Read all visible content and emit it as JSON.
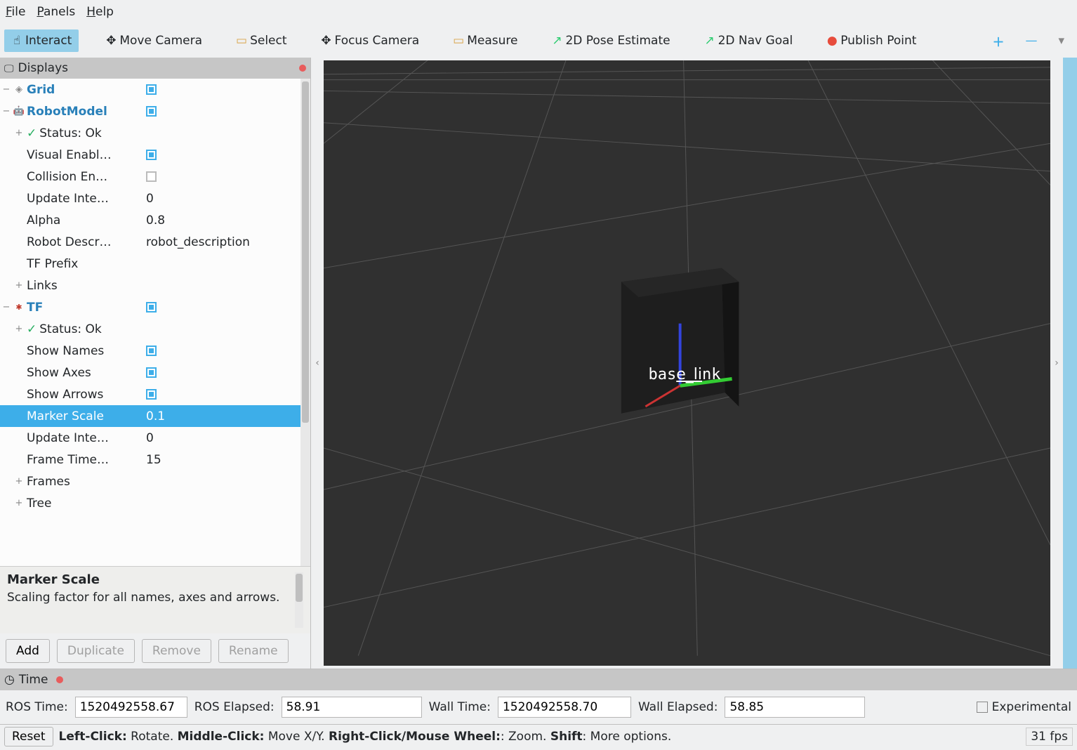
{
  "menu": {
    "file": "File",
    "panels": "Panels",
    "help": "Help"
  },
  "toolbar": {
    "interact": "Interact",
    "move_camera": "Move Camera",
    "select": "Select",
    "focus_camera": "Focus Camera",
    "measure": "Measure",
    "pose_estimate": "2D Pose Estimate",
    "nav_goal": "2D Nav Goal",
    "publish_point": "Publish Point"
  },
  "displays": {
    "title": "Displays",
    "grid": {
      "label": "Grid",
      "checked": true
    },
    "robotmodel": {
      "label": "RobotModel",
      "checked": true,
      "status": "Status: Ok",
      "visual_enabled": {
        "label": "Visual Enabl…",
        "checked": true
      },
      "collision_enabled": {
        "label": "Collision En…",
        "checked": false
      },
      "update_interval": {
        "label": "Update Inte…",
        "value": "0"
      },
      "alpha": {
        "label": "Alpha",
        "value": "0.8"
      },
      "robot_description": {
        "label": "Robot Descr…",
        "value": "robot_description"
      },
      "tf_prefix": {
        "label": "TF Prefix",
        "value": ""
      },
      "links": {
        "label": "Links"
      }
    },
    "tf": {
      "label": "TF",
      "checked": true,
      "status": "Status: Ok",
      "show_names": {
        "label": "Show Names",
        "checked": true
      },
      "show_axes": {
        "label": "Show Axes",
        "checked": true
      },
      "show_arrows": {
        "label": "Show Arrows",
        "checked": true
      },
      "marker_scale": {
        "label": "Marker Scale",
        "value": "0.1"
      },
      "update_interval": {
        "label": "Update Inte…",
        "value": "0"
      },
      "frame_timeout": {
        "label": "Frame Time…",
        "value": "15"
      },
      "frames": {
        "label": "Frames"
      },
      "tree": {
        "label": "Tree"
      }
    }
  },
  "description": {
    "title": "Marker Scale",
    "body": "Scaling factor for all names, axes and arrows."
  },
  "buttons": {
    "add": "Add",
    "duplicate": "Duplicate",
    "remove": "Remove",
    "rename": "Rename"
  },
  "viewport": {
    "frame_label": "base_link"
  },
  "time": {
    "title": "Time",
    "ros_time_label": "ROS Time:",
    "ros_time": "1520492558.67",
    "ros_elapsed_label": "ROS Elapsed:",
    "ros_elapsed": "58.91",
    "wall_time_label": "Wall Time:",
    "wall_time": "1520492558.70",
    "wall_elapsed_label": "Wall Elapsed:",
    "wall_elapsed": "58.85",
    "experimental": "Experimental"
  },
  "status": {
    "reset": "Reset",
    "hint_left": "Left-Click:",
    "hint_left_t": " Rotate. ",
    "hint_mid": "Middle-Click:",
    "hint_mid_t": " Move X/Y. ",
    "hint_right": "Right-Click/Mouse Wheel:",
    "hint_right_t": ": Zoom. ",
    "hint_shift": "Shift",
    "hint_shift_t": ": More options.",
    "fps": "31 fps"
  }
}
